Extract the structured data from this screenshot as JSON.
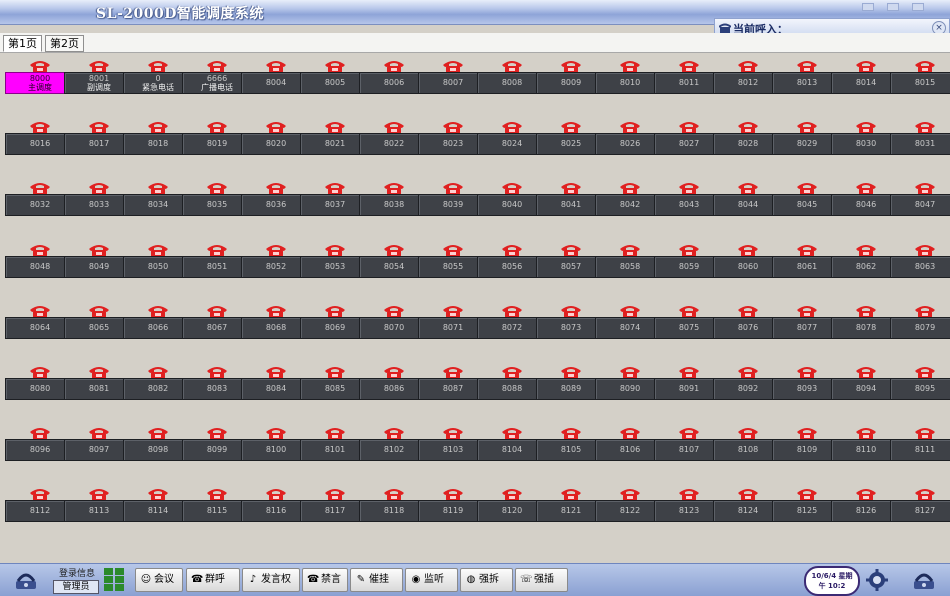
{
  "window": {
    "title": "SL-2000D智能调度系统"
  },
  "incoming": {
    "label": "当前呼入："
  },
  "tabs": [
    {
      "label": "第1页",
      "active": true
    },
    {
      "label": "第2页",
      "active": false
    }
  ],
  "extensions": [
    {
      "number": "8000",
      "name": "主调度",
      "highlight": true
    },
    {
      "number": "8001",
      "name": "副调度"
    },
    {
      "number": "0",
      "name": "紧急电话"
    },
    {
      "number": "6666",
      "name": "广播电话"
    },
    {
      "number": "8004"
    },
    {
      "number": "8005"
    },
    {
      "number": "8006"
    },
    {
      "number": "8007"
    },
    {
      "number": "8008"
    },
    {
      "number": "8009"
    },
    {
      "number": "8010"
    },
    {
      "number": "8011"
    },
    {
      "number": "8012"
    },
    {
      "number": "8013"
    },
    {
      "number": "8014"
    },
    {
      "number": "8015"
    },
    {
      "number": "8016"
    },
    {
      "number": "8017"
    },
    {
      "number": "8018"
    },
    {
      "number": "8019"
    },
    {
      "number": "8020"
    },
    {
      "number": "8021"
    },
    {
      "number": "8022"
    },
    {
      "number": "8023"
    },
    {
      "number": "8024"
    },
    {
      "number": "8025"
    },
    {
      "number": "8026"
    },
    {
      "number": "8027"
    },
    {
      "number": "8028"
    },
    {
      "number": "8029"
    },
    {
      "number": "8030"
    },
    {
      "number": "8031"
    },
    {
      "number": "8032"
    },
    {
      "number": "8033"
    },
    {
      "number": "8034"
    },
    {
      "number": "8035"
    },
    {
      "number": "8036"
    },
    {
      "number": "8037"
    },
    {
      "number": "8038"
    },
    {
      "number": "8039"
    },
    {
      "number": "8040"
    },
    {
      "number": "8041"
    },
    {
      "number": "8042"
    },
    {
      "number": "8043"
    },
    {
      "number": "8044"
    },
    {
      "number": "8045"
    },
    {
      "number": "8046"
    },
    {
      "number": "8047"
    },
    {
      "number": "8048"
    },
    {
      "number": "8049"
    },
    {
      "number": "8050"
    },
    {
      "number": "8051"
    },
    {
      "number": "8052"
    },
    {
      "number": "8053"
    },
    {
      "number": "8054"
    },
    {
      "number": "8055"
    },
    {
      "number": "8056"
    },
    {
      "number": "8057"
    },
    {
      "number": "8058"
    },
    {
      "number": "8059"
    },
    {
      "number": "8060"
    },
    {
      "number": "8061"
    },
    {
      "number": "8062"
    },
    {
      "number": "8063"
    },
    {
      "number": "8064"
    },
    {
      "number": "8065"
    },
    {
      "number": "8066"
    },
    {
      "number": "8067"
    },
    {
      "number": "8068"
    },
    {
      "number": "8069"
    },
    {
      "number": "8070"
    },
    {
      "number": "8071"
    },
    {
      "number": "8072"
    },
    {
      "number": "8073"
    },
    {
      "number": "8074"
    },
    {
      "number": "8075"
    },
    {
      "number": "8076"
    },
    {
      "number": "8077"
    },
    {
      "number": "8078"
    },
    {
      "number": "8079"
    },
    {
      "number": "8080"
    },
    {
      "number": "8081"
    },
    {
      "number": "8082"
    },
    {
      "number": "8083"
    },
    {
      "number": "8084"
    },
    {
      "number": "8085"
    },
    {
      "number": "8086"
    },
    {
      "number": "8087"
    },
    {
      "number": "8088"
    },
    {
      "number": "8089"
    },
    {
      "number": "8090"
    },
    {
      "number": "8091"
    },
    {
      "number": "8092"
    },
    {
      "number": "8093"
    },
    {
      "number": "8094"
    },
    {
      "number": "8095"
    },
    {
      "number": "8096"
    },
    {
      "number": "8097"
    },
    {
      "number": "8098"
    },
    {
      "number": "8099"
    },
    {
      "number": "8100"
    },
    {
      "number": "8101"
    },
    {
      "number": "8102"
    },
    {
      "number": "8103"
    },
    {
      "number": "8104"
    },
    {
      "number": "8105"
    },
    {
      "number": "8106"
    },
    {
      "number": "8107"
    },
    {
      "number": "8108"
    },
    {
      "number": "8109"
    },
    {
      "number": "8110"
    },
    {
      "number": "8111"
    },
    {
      "number": "8112"
    },
    {
      "number": "8113"
    },
    {
      "number": "8114"
    },
    {
      "number": "8115"
    },
    {
      "number": "8116"
    },
    {
      "number": "8117"
    },
    {
      "number": "8118"
    },
    {
      "number": "8119"
    },
    {
      "number": "8120"
    },
    {
      "number": "8121"
    },
    {
      "number": "8122"
    },
    {
      "number": "8123"
    },
    {
      "number": "8124"
    },
    {
      "number": "8125"
    },
    {
      "number": "8126"
    },
    {
      "number": "8127"
    }
  ],
  "footer": {
    "login_title": "登录信息",
    "login_user": "管理员",
    "buttons": [
      {
        "label": "会议",
        "icon": "meeting-icon"
      },
      {
        "label": "群呼",
        "icon": "group-call-icon"
      },
      {
        "label": "发言权",
        "icon": "speaker-icon"
      },
      {
        "label": "禁言",
        "icon": "mute-icon"
      },
      {
        "label": "催挂",
        "icon": "hangup-prompt-icon"
      },
      {
        "label": "监听",
        "icon": "monitor-icon"
      },
      {
        "label": "强拆",
        "icon": "force-release-icon"
      },
      {
        "label": "强插",
        "icon": "force-insert-icon"
      }
    ],
    "clock_date": "10/6/4 星期",
    "clock_time": "午 10:2"
  },
  "colors": {
    "highlight": "#ff00ff",
    "tile": "#3e4147",
    "phone": "#e02020",
    "titlebar": "#8ea4d8"
  }
}
